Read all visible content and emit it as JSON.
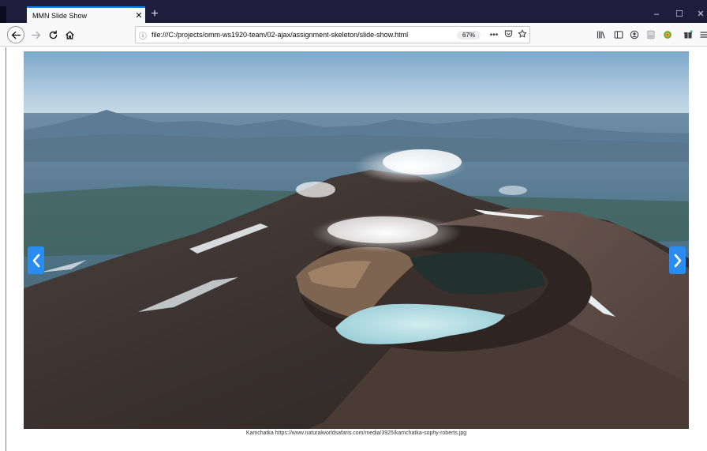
{
  "browser": {
    "tab_title": "MMN Slide Show",
    "tab_close": "✕",
    "new_tab": "+",
    "url": "file:///C:/projects/omm-ws1920-team/02-ajax/assignment-skeleton/slide-show.html",
    "zoom": "67%",
    "page_actions": "•••",
    "window_controls": {
      "minimize": "–",
      "maximize": "☐",
      "close": "✕"
    }
  },
  "slideshow": {
    "caption": "Kamchatka https://www.naturalworldsafaris.com/media/3925/kamchatka-sophy-roberts.jpg",
    "prev_label": "previous slide",
    "next_label": "next slide",
    "accent_color": "#2a8cf0"
  },
  "icons": {
    "back": "arrow-left-icon",
    "forward": "arrow-right-icon",
    "reload": "reload-icon",
    "home": "home-icon",
    "info": "info-icon",
    "pocket": "pocket-icon",
    "bookmark": "star-icon",
    "library": "library-icon",
    "sidebar": "sidebar-icon",
    "account": "account-icon",
    "reader": "reader-icon",
    "extension": "extension-icon",
    "gift": "gift-icon",
    "menu": "hamburger-menu-icon"
  }
}
